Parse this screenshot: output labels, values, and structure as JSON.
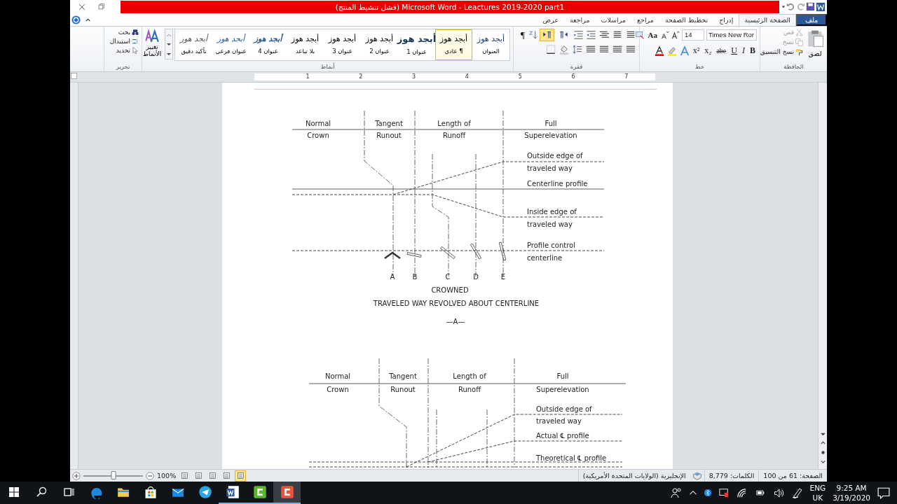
{
  "title_bar": {
    "title": "(فشل تنشيط المنتج) Microsoft Word - Leactures 2019-2020 part1"
  },
  "file_tab": {
    "label": "ملف"
  },
  "tabs": [
    {
      "label": "الصفحة الرئيسية",
      "selected": true
    },
    {
      "label": "إدراج",
      "selected": false
    },
    {
      "label": "تخطيط الصفحة",
      "selected": false
    },
    {
      "label": "مراجع",
      "selected": false
    },
    {
      "label": "مراسلات",
      "selected": false
    },
    {
      "label": "مراجعة",
      "selected": false
    },
    {
      "label": "عرض",
      "selected": false
    }
  ],
  "clipboard": {
    "title": "الحافظة",
    "paste": "لصق",
    "items": [
      {
        "label": "قص",
        "disabled": true
      },
      {
        "label": "نسخ",
        "disabled": true
      },
      {
        "label": "نسخ التنسيق",
        "disabled": false
      }
    ]
  },
  "font": {
    "title": "خط",
    "font_name": "Times New Ror",
    "font_size": "14",
    "size_buttons": [
      "Aa"
    ],
    "format_buttons": [
      {
        "label": "B",
        "kind": "bold"
      },
      {
        "label": "I",
        "kind": "italic"
      },
      {
        "label": "U",
        "kind": "underline"
      },
      {
        "label": "abe",
        "kind": "strike"
      },
      {
        "label": "x₂",
        "kind": "plain"
      },
      {
        "label": "x²",
        "kind": "plain"
      }
    ]
  },
  "paragraph": {
    "title": "فقرة",
    "show_marks": "¶",
    "text_direction": [
      {
        "kind": "rtl",
        "selected": false
      },
      {
        "kind": "ltr",
        "selected": true
      }
    ]
  },
  "styles": {
    "title": "أنماط",
    "change_styles": "تغيير الأنماط",
    "items": [
      {
        "sample": "أبجد هوز",
        "label": "العنوان",
        "kind": "title",
        "selected": false
      },
      {
        "sample": "أبجد هوز",
        "label": "¶ عادي",
        "kind": "normal",
        "selected": true
      },
      {
        "sample": "أبجد هوز",
        "label": "عنوان 1",
        "kind": "h1",
        "selected": false
      },
      {
        "sample": "أبجد هوز",
        "label": "عنوان 2",
        "kind": "normal",
        "selected": false
      },
      {
        "sample": "أبجد هوز",
        "label": "عنوان 3",
        "kind": "normal",
        "selected": false
      },
      {
        "sample": "أبجد هوز",
        "label": "بلا تباعد",
        "kind": "normal",
        "selected": false
      },
      {
        "sample": "أبجد هوز",
        "label": "عنوان 4",
        "kind": "h4",
        "selected": false
      },
      {
        "sample": "أبجد هوز",
        "label": "عنوان فرعي",
        "kind": "subtitle",
        "selected": false
      },
      {
        "sample": "أبجد هوز",
        "label": "تأكيد دقيق",
        "kind": "emphasis",
        "selected": false
      }
    ]
  },
  "editing": {
    "title": "تحرير",
    "items": [
      "بحث",
      "استبدال",
      "تحديد"
    ]
  },
  "ruler": [
    "7",
    "6",
    "5",
    "4",
    "3",
    "2",
    "1"
  ],
  "figures": [
    {
      "header": [
        {
          "top": "Full",
          "bottom": "Superelevation"
        },
        {
          "top": "Length of",
          "bottom": "Runoff"
        },
        {
          "top": "Tangent",
          "bottom": "Runout"
        },
        {
          "top": "Normal",
          "bottom": "Crown"
        }
      ],
      "side_labels": [
        "Outside edge of",
        "traveled way",
        "Centerline profile",
        "Inside edge of",
        "traveled way",
        "Profile control",
        "centerline"
      ],
      "stations": [
        "E",
        "D",
        "C",
        "B",
        "A"
      ],
      "caption": "CROWNED",
      "title": "TRAVELED WAY REVOLVED ABOUT CENTERLINE",
      "label": "—A—"
    },
    {
      "header": [
        {
          "top": "Full",
          "bottom": "Superelevation"
        },
        {
          "top": "Length of",
          "bottom": "Runoff"
        },
        {
          "top": "Tangent",
          "bottom": "Runout"
        },
        {
          "top": "Normal",
          "bottom": "Crown"
        }
      ],
      "side_labels": [
        "Outside edge of",
        "traveled way",
        "Actual ℄ profile",
        "Theoretical ℄ profile"
      ]
    }
  ],
  "status_bar": {
    "page": "الصفحة: 61 من 100",
    "words": "الكلمات: 8,779",
    "language": "الإنجليزية (الولايات المتحدة الأمريكية)",
    "zoom": "100%",
    "zoom_slider": {
      "level": 0.5
    },
    "views": [
      {
        "selected": false
      },
      {
        "selected": false
      },
      {
        "selected": false
      },
      {
        "selected": false
      },
      {
        "selected": true
      }
    ]
  },
  "taskbar": {
    "apps": [
      {
        "kind": "edge",
        "open": false,
        "selected": false
      },
      {
        "kind": "folder",
        "open": false,
        "selected": false
      },
      {
        "kind": "store",
        "open": false,
        "selected": false
      },
      {
        "kind": "mail",
        "open": false,
        "selected": false
      },
      {
        "kind": "telegram",
        "open": false,
        "selected": false
      },
      {
        "kind": "word",
        "open": true,
        "selected": false
      },
      {
        "kind": "green",
        "open": true,
        "selected": false
      },
      {
        "kind": "red",
        "open": true,
        "selected": true
      }
    ],
    "language": "ENG",
    "region": "UK",
    "time": "9:25 AM",
    "date": "3/19/2020"
  }
}
